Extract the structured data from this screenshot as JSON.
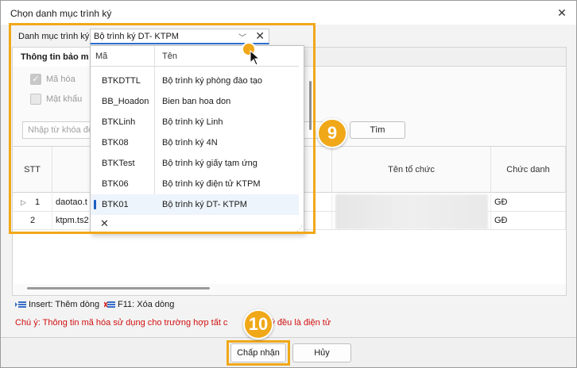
{
  "window": {
    "title": "Chọn danh mục trình ký",
    "close_icon": "close-icon"
  },
  "combo": {
    "label": "Danh mục trình ký",
    "value": "Bộ trình ký DT- KTPM"
  },
  "tab": {
    "label": "Thông tin bảo m"
  },
  "options": {
    "encrypt": "Mã hóa",
    "password": "Mật khẩu"
  },
  "search": {
    "placeholder": "Nhập từ khóa để",
    "button": "Tìm"
  },
  "grid": {
    "headers": {
      "stt": "STT",
      "org": "Tên tổ chức",
      "title": "Chức danh"
    },
    "rows": [
      {
        "stt": "1",
        "name": "daotao.t",
        "title": "GĐ"
      },
      {
        "stt": "2",
        "name": "ktpm.ts2",
        "title": "GĐ"
      }
    ]
  },
  "popup": {
    "headers": {
      "code": "Mã",
      "name": "Tên"
    },
    "items": [
      {
        "code": "BTKDTTL",
        "name": "Bộ trình ký phòng đào tạo"
      },
      {
        "code": "BB_Hoadon",
        "name": "Bien ban hoa don"
      },
      {
        "code": "BTKLinh",
        "name": "Bộ trình ký Linh"
      },
      {
        "code": "BTK08",
        "name": "Bộ trình ký 4N"
      },
      {
        "code": "BTKTest",
        "name": "Bộ trình ký giấy tạm ứng"
      },
      {
        "code": "BTK06",
        "name": "Bộ trình ký điện tử KTPM"
      },
      {
        "code": "BTK01",
        "name": "Bộ trình ký DT- KTPM"
      }
    ],
    "selected_index": 6
  },
  "hints": {
    "insert": "Insert: Thêm dòng",
    "f11": "F11: Xóa dòng"
  },
  "warning": "Chú ý: Thông tin mã hóa sử dụng cho trường hợp tất c",
  "warning_tail": "ữ ký đều là điện tử",
  "footer": {
    "accept": "Chấp nhận",
    "cancel": "Hủy"
  },
  "steps": {
    "nine": "9",
    "ten": "10"
  },
  "colors": {
    "accent_orange": "#f0a818",
    "warning_red": "#d01010",
    "selection_blue": "#1e5fc0"
  }
}
